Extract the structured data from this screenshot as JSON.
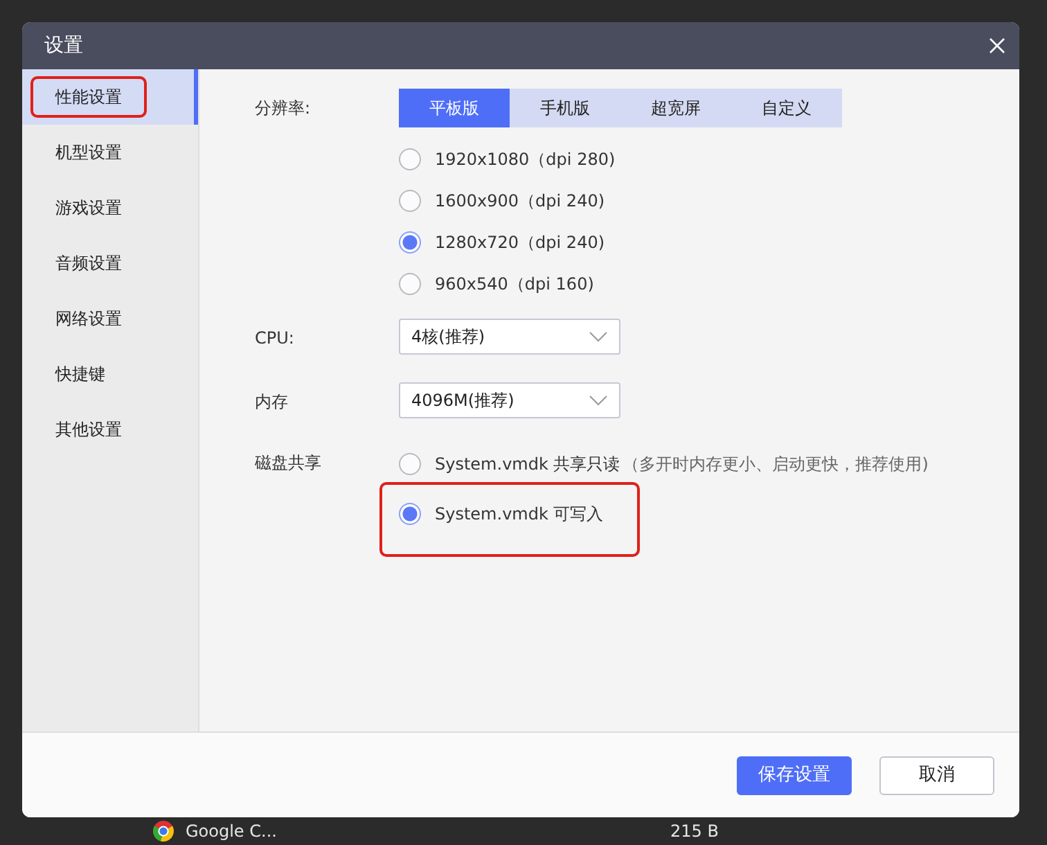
{
  "background_rows": [
    {
      "name": "Google C...",
      "size": "215 B"
    }
  ],
  "dialog": {
    "title": "设置"
  },
  "sidebar": {
    "items": [
      {
        "label": "性能设置",
        "selected": true,
        "highlighted": true
      },
      {
        "label": "机型设置",
        "selected": false,
        "highlighted": false
      },
      {
        "label": "游戏设置",
        "selected": false,
        "highlighted": false
      },
      {
        "label": "音频设置",
        "selected": false,
        "highlighted": false
      },
      {
        "label": "网络设置",
        "selected": false,
        "highlighted": false
      },
      {
        "label": "快捷键",
        "selected": false,
        "highlighted": false
      },
      {
        "label": "其他设置",
        "selected": false,
        "highlighted": false
      }
    ]
  },
  "resolution": {
    "label": "分辨率:",
    "tabs": [
      {
        "label": "平板版",
        "selected": true
      },
      {
        "label": "手机版",
        "selected": false
      },
      {
        "label": "超宽屏",
        "selected": false
      },
      {
        "label": "自定义",
        "selected": false
      }
    ],
    "options": [
      {
        "label": "1920x1080（dpi 280)",
        "selected": false
      },
      {
        "label": "1600x900（dpi 240)",
        "selected": false
      },
      {
        "label": "1280x720（dpi 240)",
        "selected": true
      },
      {
        "label": "960x540（dpi 160)",
        "selected": false
      }
    ]
  },
  "cpu": {
    "label": "CPU:",
    "value": "4核(推荐)"
  },
  "memory": {
    "label": "内存",
    "value": "4096M(推荐)"
  },
  "disk_share": {
    "label": "磁盘共享",
    "options": [
      {
        "label": "System.vmdk 共享只读",
        "hint": "（多开时内存更小、启动更快，推荐使用)",
        "selected": false,
        "highlighted": false
      },
      {
        "label": "System.vmdk 可写入",
        "selected": true,
        "highlighted": true
      }
    ]
  },
  "buttons": [
    {
      "label": "保存设置",
      "kind": "primary"
    },
    {
      "label": "取消",
      "kind": "secondary"
    }
  ]
}
